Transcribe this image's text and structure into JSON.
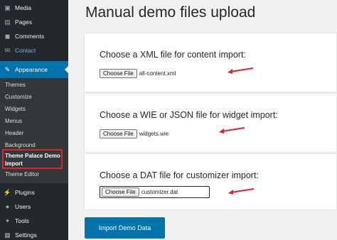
{
  "sidebar": {
    "items_top": [
      {
        "label": "Media",
        "icon": "media-icon"
      },
      {
        "label": "Pages",
        "icon": "pages-icon"
      },
      {
        "label": "Comments",
        "icon": "comments-icon"
      },
      {
        "label": "Contact",
        "icon": "contact-icon"
      }
    ],
    "active": {
      "label": "Appearance",
      "icon": "appearance-icon"
    },
    "submenu": [
      "Themes",
      "Customize",
      "Widgets",
      "Menus",
      "Header",
      "Background",
      "Theme Palace Demo Import",
      "Theme Editor"
    ],
    "items_bottom": [
      {
        "label": "Plugins",
        "icon": "plugins-icon"
      },
      {
        "label": "Users",
        "icon": "users-icon"
      },
      {
        "label": "Tools",
        "icon": "tools-icon"
      },
      {
        "label": "Settings",
        "icon": "settings-icon"
      }
    ]
  },
  "main": {
    "title": "Manual demo files upload",
    "sections": [
      {
        "title": "Choose a XML file for content import:",
        "button": "Choose File",
        "file": "all-content.xml"
      },
      {
        "title": "Choose a WIE or JSON file for widget import:",
        "button": "Choose File",
        "file": "widgets.wie"
      },
      {
        "title": "Choose a DAT file for customizer import:",
        "button": "Choose File",
        "file": "customizer.dat"
      }
    ],
    "import_button": "Import Demo Data"
  },
  "colors": {
    "accent": "#0073aa",
    "sidebar": "#23282d",
    "annotation": "#e0242a"
  }
}
